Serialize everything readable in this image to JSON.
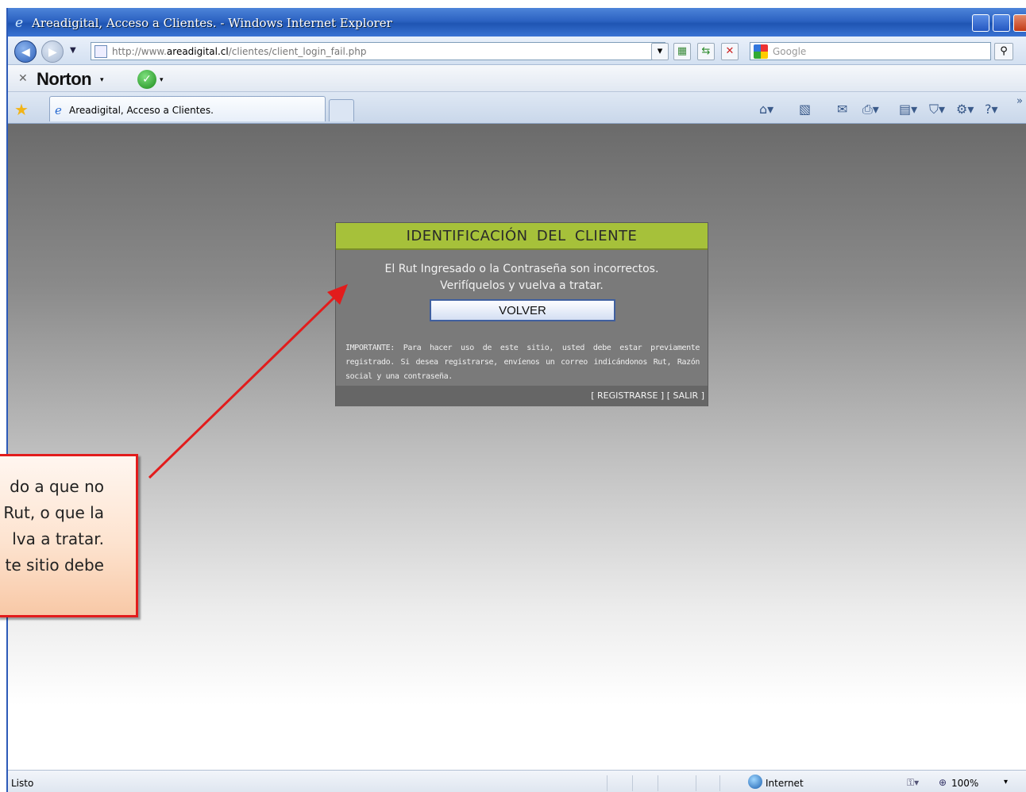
{
  "window": {
    "title": "Areadigital, Acceso a Clientes. - Windows Internet Explorer",
    "colors": {
      "titlebar": "#2c63c2",
      "close": "#c23b18"
    }
  },
  "navbar": {
    "address_prefix": "http://www.",
    "address_host": "areadigital.cl",
    "address_path": "/clientes/client_login_fail.php",
    "search_placeholder": "Google"
  },
  "toolbar": {
    "norton_label": "Norton"
  },
  "tabs": [
    {
      "label": "Areadigital, Acceso a Clientes."
    }
  ],
  "page": {
    "panel_title": "IDENTIFICACIÓN  DEL  CLIENTE",
    "message_line1": "El Rut Ingresado o la Contraseña son incorrectos.",
    "message_line2": "Verifíquelos y vuelva a tratar.",
    "volver_label": "VOLVER",
    "important_text": "IMPORTANTE: Para hacer uso de este sitio, usted debe estar previamente registrado. Si desea registrarse, envíenos un correo indicándonos Rut, Razón social y una contraseña.",
    "link_register": "[ REGISTRARSE ]",
    "link_exit": "[ SALIR ]",
    "colors": {
      "panel_header": "#a6c13a",
      "panel_bg": "#7a7a7a"
    }
  },
  "callout": {
    "lines": [
      "do a que no",
      "Rut, o que la",
      "lva a tratar.",
      "te sitio debe"
    ],
    "colors": {
      "border": "#e21c1c",
      "arrow": "#e21c1c"
    }
  },
  "statusbar": {
    "status": "Listo",
    "zone": "Internet",
    "zoom": "100%"
  },
  "icons": [
    "ie-icon",
    "back-icon",
    "forward-icon",
    "page-icon",
    "refresh-icon",
    "stop-icon",
    "search-icon",
    "norton-check-icon",
    "favorites-star-icon",
    "home-icon",
    "feeds-icon",
    "print-icon",
    "tools-icon",
    "help-icon",
    "globe-icon",
    "zoom-icon"
  ]
}
